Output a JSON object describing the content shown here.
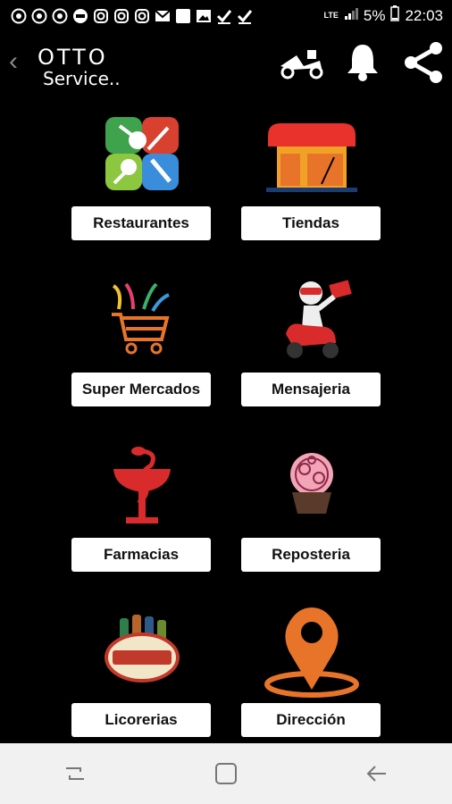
{
  "status_bar": {
    "notifications": [
      "whatsapp-icon",
      "whatsapp-icon",
      "whatsapp-icon",
      "gif-icon",
      "instagram-icon",
      "instagram-icon",
      "instagram-icon",
      "gmail-icon",
      "square-icon",
      "image-icon",
      "check-icon",
      "check-icon"
    ],
    "network": "LTE",
    "battery": "5%",
    "time": "22:03"
  },
  "app_bar": {
    "logo_line1": "OTTO",
    "logo_line2": "Service.."
  },
  "menu": [
    {
      "label": "Restaurantes",
      "icon": "restaurant-icon"
    },
    {
      "label": "Tiendas",
      "icon": "store-icon"
    },
    {
      "label": "Super Mercados",
      "icon": "shopping-cart-icon"
    },
    {
      "label": "Mensajeria",
      "icon": "courier-icon"
    },
    {
      "label": "Farmacias",
      "icon": "pharmacy-icon"
    },
    {
      "label": "Reposteria",
      "icon": "cupcake-icon"
    },
    {
      "label": "Licorerias",
      "icon": "liquors-icon"
    },
    {
      "label": "Dirección",
      "icon": "location-pin-icon"
    }
  ],
  "colors": {
    "accent": "#e8742a",
    "red": "#d92b2b",
    "background": "#000000",
    "navbar": "#f1f1f1"
  }
}
